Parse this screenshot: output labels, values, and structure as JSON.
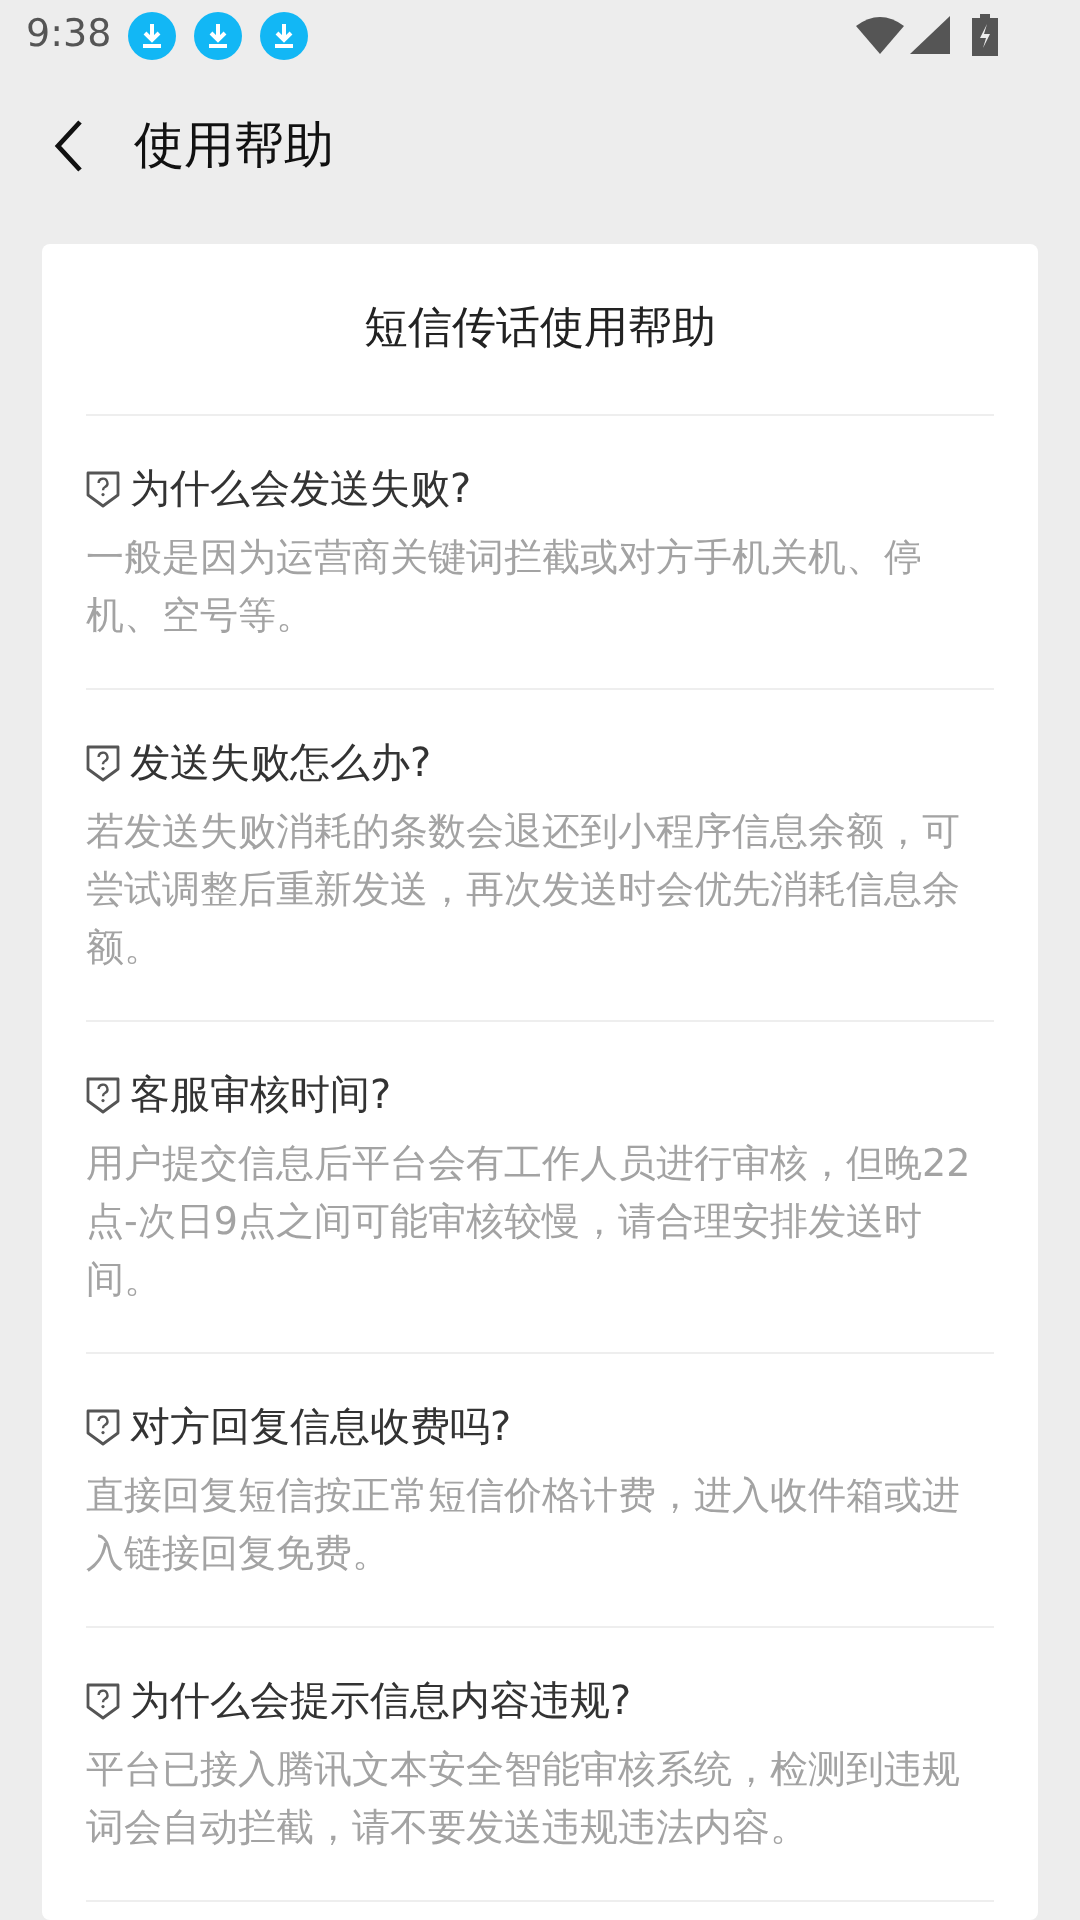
{
  "status_bar": {
    "time": "9:38",
    "notifications": [
      {
        "kind": "download"
      },
      {
        "kind": "download"
      },
      {
        "kind": "download"
      }
    ]
  },
  "header": {
    "title": "使用帮助"
  },
  "card": {
    "title": "短信传话使用帮助",
    "items": [
      {
        "question": "为什么会发送失败?",
        "answer": "一般是因为运营商关键词拦截或对方手机关机、停机、空号等。"
      },
      {
        "question": "发送失败怎么办?",
        "answer": "若发送失败消耗的条数会退还到小程序信息余额，可尝试调整后重新发送，再次发送时会优先消耗信息余额。"
      },
      {
        "question": "客服审核时间?",
        "answer": "用户提交信息后平台会有工作人员进行审核，但晚22点-次日9点之间可能审核较慢，请合理安排发送时间。"
      },
      {
        "question": "对方回复信息收费吗?",
        "answer": "直接回复短信按正常短信价格计费，进入收件箱或进入链接回复免费。"
      },
      {
        "question": "为什么会提示信息内容违规?",
        "answer": "平台已接入腾讯文本安全智能审核系统，检测到违规词会自动拦截，请不要发送违规违法内容。"
      }
    ]
  }
}
